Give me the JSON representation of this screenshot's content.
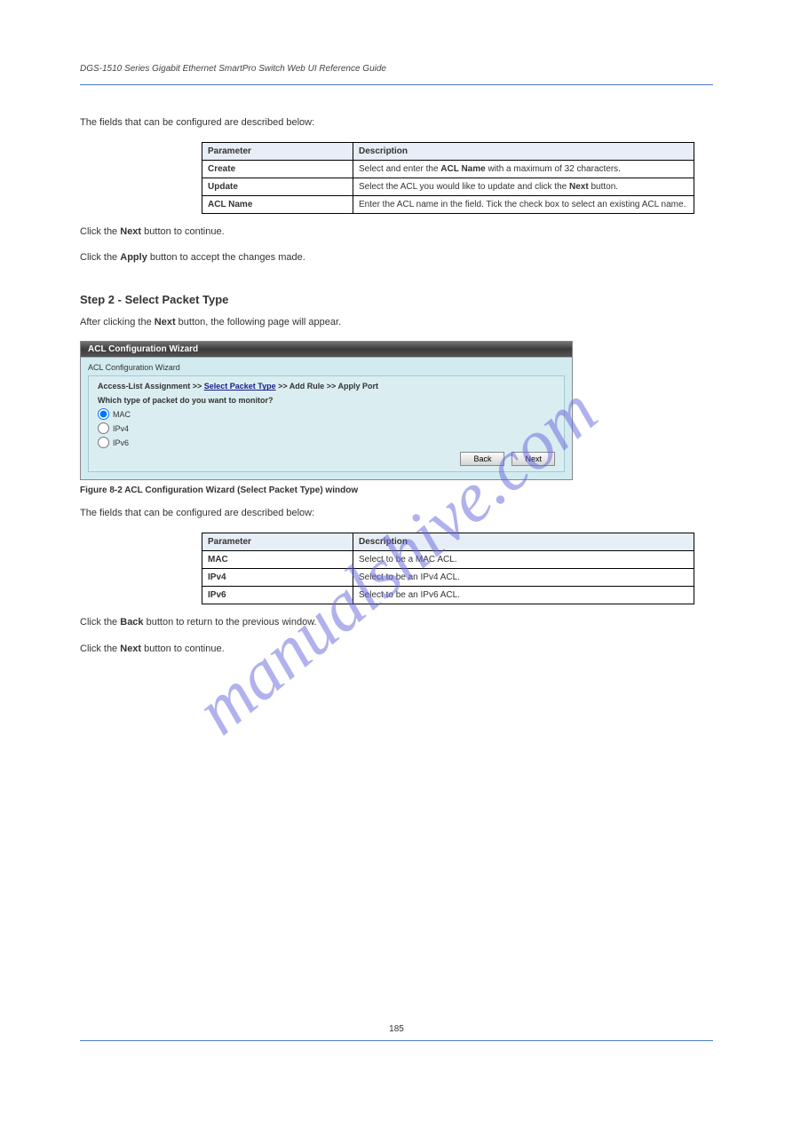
{
  "header": {
    "left": "DGS-1510 Series Gigabit Ethernet SmartPro Switch Web UI Reference Guide",
    "right": ""
  },
  "watermark": "manualshive.com",
  "intro_text": "The fields that can be configured are described below:",
  "table1": {
    "headers": [
      "Parameter",
      "Description"
    ],
    "rows": [
      {
        "param": "Create",
        "desc_prefix": "Select and enter the ",
        "desc_bold": "ACL Name",
        "desc_suffix": " with a maximum of 32 characters."
      },
      {
        "param": "Update",
        "desc_prefix": "Select the ACL you would like to update and click the ",
        "desc_bold": "Next",
        "desc_suffix": " button."
      },
      {
        "param": "ACL Name",
        "desc_prefix": "Enter the ACL name in the field. Tick the check box to select an existing ACL name.",
        "desc_bold": "",
        "desc_suffix": ""
      }
    ]
  },
  "mid_text1_pre": "Click the ",
  "mid_text1_bold": "Next",
  "mid_text1_post": " button to continue.",
  "mid_text2_pre": "Click the ",
  "mid_text2_bold": "Apply",
  "mid_text2_post": " button to accept the changes made.",
  "section_heading": "Step 2 - Select Packet Type",
  "section_text_pre": "After clicking the ",
  "section_text_bold": "Next",
  "section_text_post": " button, the following page will appear.",
  "wizard": {
    "title": "ACL Configuration Wizard",
    "group_label": "ACL Configuration Wizard",
    "breadcrumb_step1": "Access-List Assignment",
    "breadcrumb_sep": " >> ",
    "breadcrumb_step2": "Select Packet Type",
    "breadcrumb_step3": "Add Rule",
    "breadcrumb_step4": "Apply Port",
    "prompt": "Which type of packet do you want to monitor?",
    "options": {
      "mac": "MAC",
      "ipv4": "IPv4",
      "ipv6": "IPv6"
    },
    "buttons": {
      "back": "Back",
      "next": "Next"
    }
  },
  "figure_caption": "Figure 8-2 ACL Configuration Wizard (Select Packet Type) window",
  "table2_intro": "The fields that can be configured are described below:",
  "table2": {
    "headers": [
      "Parameter",
      "Description"
    ],
    "rows": [
      {
        "param": "MAC",
        "desc": "Select to be a MAC ACL."
      },
      {
        "param": "IPv4",
        "desc": "Select to be an IPv4 ACL."
      },
      {
        "param": "IPv6",
        "desc": "Select to be an IPv6 ACL."
      }
    ]
  },
  "post_text1_pre": "Click the ",
  "post_text1_bold": "Back",
  "post_text1_post": " button to return to the previous window.",
  "post_text2_pre": "Click the ",
  "post_text2_bold": "Next",
  "post_text2_post": " button to continue.",
  "page_number": "185"
}
